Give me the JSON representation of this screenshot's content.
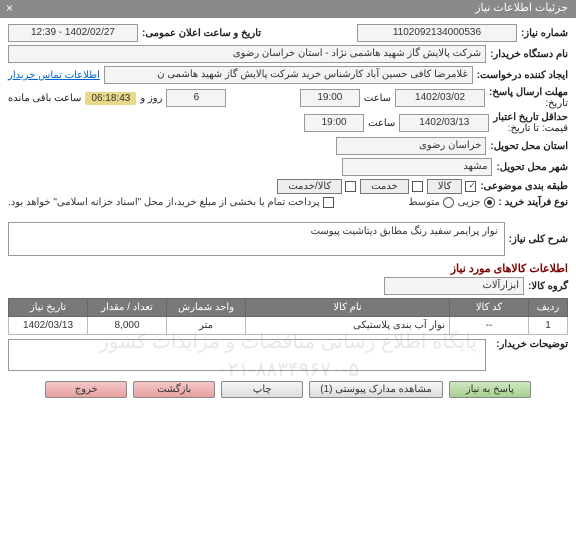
{
  "window": {
    "title": "جزئیات اطلاعات نیاز"
  },
  "header": {
    "need_no_lbl": "شماره نیاز:",
    "need_no": "1102092134000536",
    "announce_lbl": "تاریخ و ساعت اعلان عمومی:",
    "announce_val": "1402/02/27 - 12:39",
    "buyer_lbl": "نام دستگاه خریدار:",
    "buyer_val": "شرکت پالایش گاز شهید هاشمی نژاد - استان خراسان رضوی",
    "requester_lbl": "ایجاد کننده درخواست:",
    "requester_val": "غلامرضا کافی حسین آباد کارشناس خرید شرکت پالایش گاز شهید هاشمی ن",
    "contact_link": "اطلاعات تماس خریدار",
    "deadline_lbl": "مهلت ارسال پاسخ:",
    "deadline_sub": "تاریخ:",
    "deadline_date": "1402/03/02",
    "time_lbl": "ساعت",
    "deadline_time": "19:00",
    "days_val": "6",
    "days_unit": "روز و",
    "countdown": "06:18:43",
    "countdown_tail": "ساعت باقی مانده",
    "validity_lbl": "حداقل تاریخ اعتبار",
    "validity_sub": "قیمت: تا تاریخ:",
    "validity_date": "1402/03/13",
    "validity_time": "19:00",
    "province_lbl": "استان محل تحویل:",
    "province_val": "خراسان رضوی",
    "city_lbl": "شهر محل تحویل:",
    "city_val": "مشهد",
    "class_lbl": "طبقه بندی موضوعی:",
    "class_kala": "کالا",
    "class_service": "خدمت",
    "class_both": "کالا/خدمت",
    "proc_lbl": "نوع فرآیند خرید :",
    "proc_partial": "جزیی",
    "proc_medium": "متوسط",
    "pay_note": "پرداخت تمام یا بخشی از مبلغ خرید،از محل \"اسناد خزانه اسلامی\" خواهد بود."
  },
  "desc": {
    "lbl": "شرح کلی نیاز:",
    "val": "نوار پرایمر سفید رنگ مطابق دیتاشیت پیوست"
  },
  "items_section": {
    "title": "اطلاعات کالاهای مورد نیاز",
    "group_lbl": "گروه کالا:",
    "group_val": "ابزارآلات"
  },
  "table": {
    "headers": {
      "row": "ردیف",
      "code": "کد کالا",
      "name": "نام کالا",
      "unit": "واحد شمارش",
      "qty": "تعداد / مقدار",
      "date": "تاریخ نیاز"
    },
    "rows": [
      {
        "row": "1",
        "code": "--",
        "name": "نوار آب بندی پلاستیکی",
        "unit": "متر",
        "qty": "8,000",
        "date": "1402/03/13"
      }
    ]
  },
  "notes_lbl": "توضیحات خریدار:",
  "buttons": {
    "respond": "پاسخ به نیاز",
    "attachments": "مشاهده مدارک پیوستی (1)",
    "print": "چاپ",
    "back": "بازگشت",
    "exit": "خروج"
  },
  "watermark": {
    "l1": "پایگاه اطلاع رسانی مناقصات و مزایدات کشور",
    "l2": "۰۲۱-۸۸۳۴۹۶۷۰-۵"
  }
}
